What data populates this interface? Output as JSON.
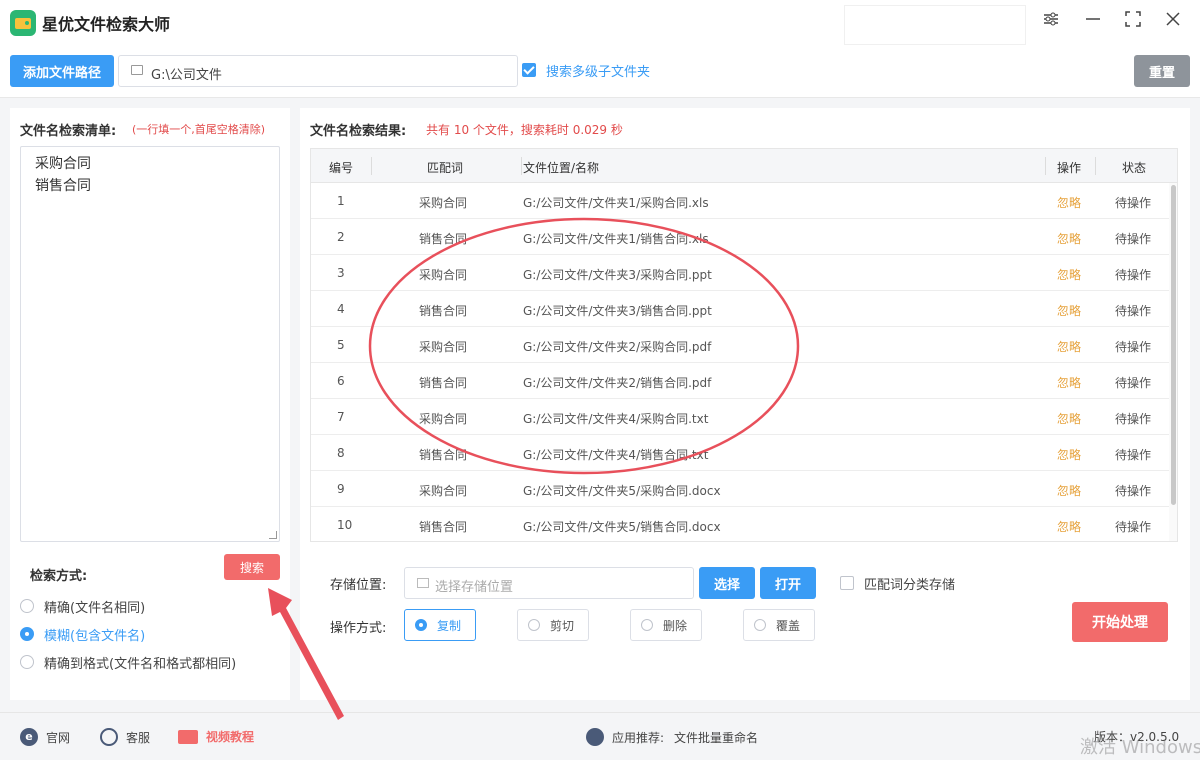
{
  "app": {
    "title": "星优文件检索大师"
  },
  "window_controls": [
    "settings-icon",
    "minimize-icon",
    "maximize-icon",
    "close-icon"
  ],
  "toolbar": {
    "add_path_label": "添加文件路径",
    "path_value": "G:\\公司文件",
    "subfolder_label": "搜索多级子文件夹",
    "subfolder_checked": true,
    "reset_label": "重置"
  },
  "left": {
    "list_title": "文件名检索清单:",
    "list_hint": "(一行填一个,首尾空格清除)",
    "keywords": [
      "采购合同",
      "销售合同"
    ],
    "mode_title": "检索方式:",
    "search_label": "搜索",
    "modes": [
      {
        "label": "精确(文件名相同)",
        "selected": false
      },
      {
        "label": "模糊(包含文件名)",
        "selected": true
      },
      {
        "label": "精确到格式(文件名和格式都相同)",
        "selected": false
      }
    ]
  },
  "right": {
    "results_title": "文件名检索结果:",
    "summary": "共有 10 个文件，搜索耗时 0.029 秒",
    "columns": [
      "编号",
      "匹配词",
      "文件位置/名称",
      "操作",
      "状态"
    ],
    "rows": [
      {
        "no": "1",
        "kw": "采购合同",
        "path": "G:/公司文件/文件夹1/采购合同.xls",
        "op": "忽略",
        "status": "待操作"
      },
      {
        "no": "2",
        "kw": "销售合同",
        "path": "G:/公司文件/文件夹1/销售合同.xls",
        "op": "忽略",
        "status": "待操作"
      },
      {
        "no": "3",
        "kw": "采购合同",
        "path": "G:/公司文件/文件夹3/采购合同.ppt",
        "op": "忽略",
        "status": "待操作"
      },
      {
        "no": "4",
        "kw": "销售合同",
        "path": "G:/公司文件/文件夹3/销售合同.ppt",
        "op": "忽略",
        "status": "待操作"
      },
      {
        "no": "5",
        "kw": "采购合同",
        "path": "G:/公司文件/文件夹2/采购合同.pdf",
        "op": "忽略",
        "status": "待操作"
      },
      {
        "no": "6",
        "kw": "销售合同",
        "path": "G:/公司文件/文件夹2/销售合同.pdf",
        "op": "忽略",
        "status": "待操作"
      },
      {
        "no": "7",
        "kw": "采购合同",
        "path": "G:/公司文件/文件夹4/采购合同.txt",
        "op": "忽略",
        "status": "待操作"
      },
      {
        "no": "8",
        "kw": "销售合同",
        "path": "G:/公司文件/文件夹4/销售合同.txt",
        "op": "忽略",
        "status": "待操作"
      },
      {
        "no": "9",
        "kw": "采购合同",
        "path": "G:/公司文件/文件夹5/采购合同.docx",
        "op": "忽略",
        "status": "待操作"
      },
      {
        "no": "10",
        "kw": "销售合同",
        "path": "G:/公司文件/文件夹5/销售合同.docx",
        "op": "忽略",
        "status": "待操作"
      }
    ],
    "store_label": "存储位置:",
    "store_placeholder": "选择存储位置",
    "choose_label": "选择",
    "open_label": "打开",
    "classify_label": "匹配词分类存储",
    "classify_checked": false,
    "op_label": "操作方式:",
    "op_options": [
      {
        "label": "复制",
        "selected": true
      },
      {
        "label": "剪切",
        "selected": false
      },
      {
        "label": "删除",
        "selected": false
      },
      {
        "label": "覆盖",
        "selected": false
      }
    ],
    "start_label": "开始处理"
  },
  "footer": {
    "site_label": "官网",
    "service_label": "客服",
    "video_label": "视频教程",
    "recommend_label": "应用推荐:",
    "recommend_app": "文件批量重命名",
    "version": "版本：v2.0.5.0",
    "watermark": "激活 Windows"
  },
  "colors": {
    "accent": "#3a9cf5",
    "danger": "#f26b6b",
    "warning": "#e6a23c",
    "annotation": "#e8505b"
  }
}
